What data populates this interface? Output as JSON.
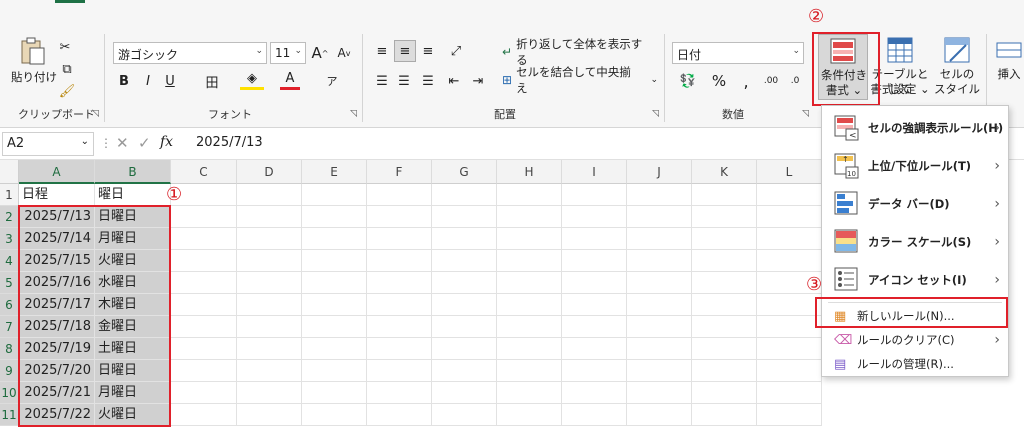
{
  "ribbon": {
    "clipboard": {
      "paste_label": "貼り付け",
      "group_label": "クリップボード"
    },
    "font": {
      "font_name": "游ゴシック",
      "font_size": "11",
      "bold": "B",
      "italic": "I",
      "underline": "U",
      "group_label": "フォント"
    },
    "alignment": {
      "wrap_text": "折り返して全体を表示する",
      "merge_center": "セルを結合して中央揃え",
      "group_label": "配置"
    },
    "number": {
      "format": "日付",
      "percent": "%",
      "group_label": "数値"
    },
    "styles": {
      "conditional_format_line1": "条件付き",
      "conditional_format_line2": "書式",
      "table_format_line1": "テーブルとして",
      "table_format_line2": "書式設定",
      "cell_styles_line1": "セルの",
      "cell_styles_line2": "スタイル"
    },
    "cells": {
      "insert_label": "挿入"
    }
  },
  "formula_bar": {
    "name_box": "A2",
    "fx": "fx",
    "content": "2025/7/13"
  },
  "columns": [
    "A",
    "B",
    "C",
    "D",
    "E",
    "F",
    "G",
    "H",
    "I",
    "J",
    "K",
    "L"
  ],
  "rows": [
    "1",
    "2",
    "3",
    "4",
    "5",
    "6",
    "7",
    "8",
    "9",
    "10",
    "11"
  ],
  "sheet": {
    "header": [
      "日程",
      "曜日"
    ],
    "data": [
      [
        "2025/7/13",
        "日曜日"
      ],
      [
        "2025/7/14",
        "月曜日"
      ],
      [
        "2025/7/15",
        "火曜日"
      ],
      [
        "2025/7/16",
        "水曜日"
      ],
      [
        "2025/7/17",
        "木曜日"
      ],
      [
        "2025/7/18",
        "金曜日"
      ],
      [
        "2025/7/19",
        "土曜日"
      ],
      [
        "2025/7/20",
        "日曜日"
      ],
      [
        "2025/7/21",
        "月曜日"
      ],
      [
        "2025/7/22",
        "火曜日"
      ]
    ]
  },
  "menu": {
    "items": [
      {
        "label": "セルの強調表示ルール(H)",
        "icon": "highlight-cells-icon"
      },
      {
        "label": "上位/下位ルール(T)",
        "icon": "top-bottom-icon"
      },
      {
        "label": "データ バー(D)",
        "icon": "data-bars-icon"
      },
      {
        "label": "カラー スケール(S)",
        "icon": "color-scales-icon"
      },
      {
        "label": "アイコン セット(I)",
        "icon": "icon-sets-icon"
      }
    ],
    "new_rule": "新しいルール(N)...",
    "clear_rules": "ルールのクリア(C)",
    "manage_rules": "ルールの管理(R)..."
  },
  "annotations": {
    "step1": "①",
    "step2": "②",
    "step3": "③"
  },
  "colors": {
    "accent_green": "#217346",
    "annotation_red": "#e0202a"
  }
}
